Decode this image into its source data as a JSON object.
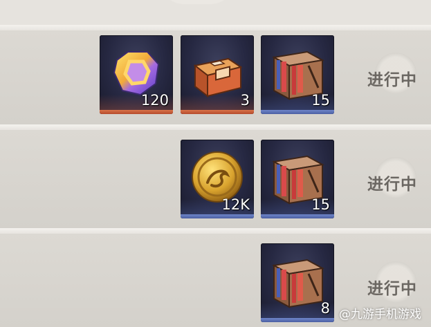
{
  "rows": [
    {
      "items": [
        {
          "name": "purple-gem",
          "icon": "gem-icon",
          "count": "120",
          "rarity": "orange"
        },
        {
          "name": "treasure-chest",
          "icon": "chest-icon",
          "count": "3",
          "rarity": "orange"
        },
        {
          "name": "book-crate",
          "icon": "book-crate-icon",
          "count": "15",
          "rarity": "blue"
        }
      ],
      "status": "进行中"
    },
    {
      "items": [
        {
          "name": "gold-coin",
          "icon": "coin-icon",
          "count": "12K",
          "rarity": "blue"
        },
        {
          "name": "book-crate",
          "icon": "book-crate-icon",
          "count": "15",
          "rarity": "blue"
        }
      ],
      "status": "进行中"
    },
    {
      "items": [
        {
          "name": "book-crate",
          "icon": "book-crate-icon",
          "count": "8",
          "rarity": "blue"
        }
      ],
      "status": "进行中"
    }
  ],
  "watermark": "@九游手机游戏",
  "colors": {
    "slot_bg": "#262842",
    "orange_bar": "#c85c3a",
    "blue_bar": "#5a6fb5",
    "status_text": "#6b6762"
  }
}
